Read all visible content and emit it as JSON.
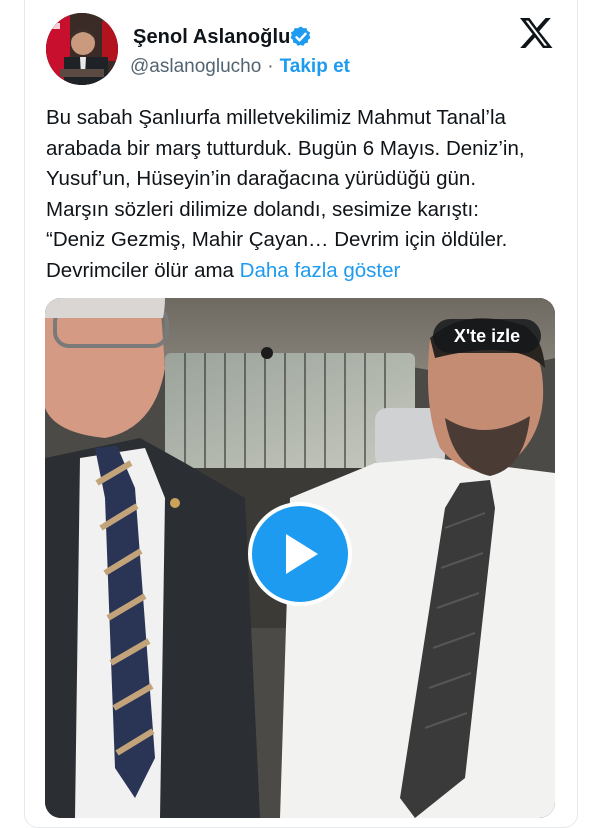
{
  "tweet": {
    "author_name": "Şenol Aslanoğlu",
    "handle": "@aslanoglucho",
    "separator": "·",
    "follow_label": "Takip et",
    "text_lines": [
      "Bu sabah Şanlıurfa milletvekilimiz Mahmut Tanal’la",
      "arabada bir marş tutturduk. Bugün 6 Mayıs. Deniz’in,",
      "Yusuf’un, Hüseyin’in darağacına yürüdüğü gün.",
      "Marşın sözleri dilimize dolandı, sesimize karıştı:",
      "“Deniz Gezmiş, Mahir Çayan… Devrim için öldüler.",
      "Devrimciler ölür ama"
    ],
    "show_more_label": "Daha fazla göster"
  },
  "media": {
    "watch_label": "X'te izle"
  },
  "icons": {
    "verified": "verified-badge-icon",
    "brand": "x-logo-icon",
    "play": "play-icon"
  },
  "colors": {
    "accent": "#1d9bf0",
    "text": "#0f1419",
    "secondary": "#536471"
  }
}
